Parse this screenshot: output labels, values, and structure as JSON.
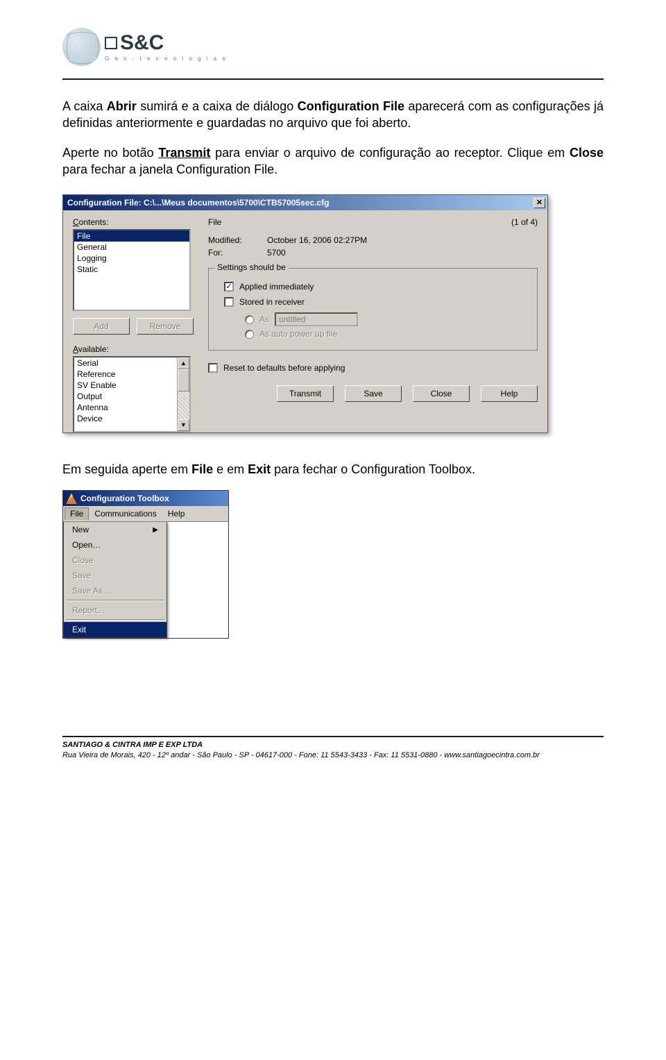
{
  "logo": {
    "brand": "S&C",
    "tagline": "G e o - t e c n o l o g i a s"
  },
  "para1": {
    "pre": "A caixa ",
    "b1": "Abrir",
    "mid1": " sumirá e a caixa de diálogo ",
    "b2": "Configuration File",
    "post": " aparecerá com as configurações já definidas anteriormente e guardadas no arquivo que foi aberto."
  },
  "para2": {
    "pre": "Aperte no botão ",
    "b1": "Transmit",
    "mid1": " para enviar o arquivo de configuração ao receptor. Clique em ",
    "b2": "Close",
    "post": " para fechar a janela Configuration File."
  },
  "dialog": {
    "title": "Configuration File: C:\\...\\Meus documentos\\5700\\CTB57005sec.cfg",
    "close_char": "✕",
    "contents_label_pre": "C",
    "contents_label_mid": "ontents:",
    "file_label": "File",
    "counter": "(1 of 4)",
    "contents": [
      "File",
      "General",
      "Logging",
      "Static"
    ],
    "add_pre": "A",
    "add_rest": "dd",
    "remove_pre": "R",
    "remove_rest": "emove",
    "available_label_pre": "A",
    "available_label_mid": "vailable:",
    "available": [
      "Serial",
      "Reference",
      "SV Enable",
      "Output",
      "Antenna",
      "Device"
    ],
    "modified_label": "Modified:",
    "modified_value": "October 16, 2006 02:27PM",
    "for_label": "For:",
    "for_value": "5700",
    "group_legend": "Settings should be",
    "cb_applied": "Applied immediately",
    "cb_stored": "Stored in receiver",
    "rb_as": "As",
    "as_value": "untitled",
    "rb_auto": "As auto power up file",
    "cb_reset": "Reset to defaults before applying",
    "btn_transmit_pre": "T",
    "btn_transmit_rest": "ransmit",
    "btn_save_pre": "S",
    "btn_save_rest": "ave",
    "btn_close": "Close",
    "btn_help_pre": "H",
    "btn_help_rest": "elp"
  },
  "para3": {
    "pre": "Em seguida aperte em ",
    "b1": "File",
    "mid1": " e em ",
    "b2": "Exit",
    "post": " para fechar o Configuration Toolbox."
  },
  "appwin": {
    "title": "Configuration Toolbox",
    "menu": {
      "file": "File",
      "comm": "Communications",
      "help": "Help"
    },
    "items": {
      "new": "New",
      "open": "Open…",
      "close": "Close",
      "save": "Save",
      "saveas": "Save As…",
      "report": "Report…",
      "exit": "Exit"
    }
  },
  "footer": {
    "line1": "SANTIAGO & CINTRA IMP E EXP LTDA",
    "line2": "Rua Vieira de Morais, 420 - 12º andar - São Paulo - SP - 04617-000 - Fone: 11 5543-3433 - Fax: 11 5531-0880 - www.santiagoecintra.com.br"
  }
}
